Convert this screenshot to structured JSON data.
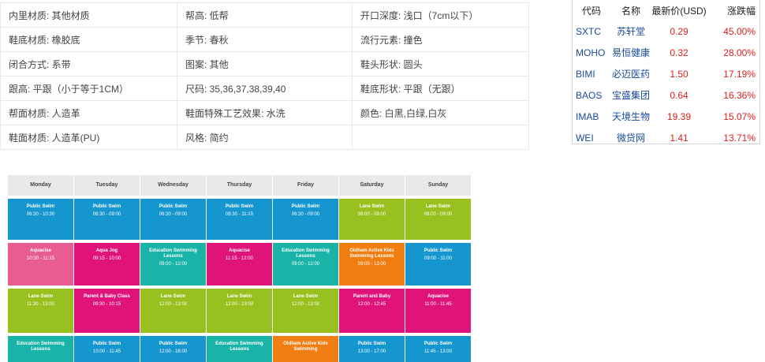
{
  "attributes": [
    [
      "内里材质: 其他材质",
      "帮高: 低帮",
      "开口深度: 浅口（7cm以下）"
    ],
    [
      "鞋底材质: 橡胶底",
      "季节: 春秋",
      "流行元素: 撞色"
    ],
    [
      "闭合方式: 系带",
      "图案: 其他",
      "鞋头形状: 圆头"
    ],
    [
      "跟高: 平跟（小于等于1CM）",
      "尺码: 35,36,37,38,39,40",
      "鞋底形状: 平跟（无跟）"
    ],
    [
      "帮面材质: 人造革",
      "鞋面特殊工艺效果: 水洗",
      "颜色: 白黑,白绿,白灰"
    ],
    [
      "鞋面材质: 人造革(PU)",
      "风格: 简约",
      ""
    ]
  ],
  "stocks": {
    "headers": {
      "code": "代码",
      "name": "名称",
      "price": "最新价(USD)",
      "change": "涨跌幅"
    },
    "rows": [
      {
        "code": "SXTC",
        "name": "苏轩堂",
        "price": "0.29",
        "change": "45.00%"
      },
      {
        "code": "MOHO",
        "name": "易恒健康",
        "price": "0.32",
        "change": "28.00%"
      },
      {
        "code": "BIMI",
        "name": "必迈医药",
        "price": "1.50",
        "change": "17.19%"
      },
      {
        "code": "BAOS",
        "name": "宝盛集团",
        "price": "0.64",
        "change": "16.36%"
      },
      {
        "code": "IMAB",
        "name": "天境生物",
        "price": "19.39",
        "change": "15.07%"
      },
      {
        "code": "WEI",
        "name": "微贷网",
        "price": "1.41",
        "change": "13.71%"
      }
    ]
  },
  "timetable": {
    "days": [
      "Monday",
      "Tuesday",
      "Wednesday",
      "Thursday",
      "Friday",
      "Saturday",
      "Sunday"
    ],
    "rows": [
      [
        {
          "title": "Public Swim",
          "time": "06:30 - 10:30",
          "color": "blue"
        },
        {
          "title": "Public Swim",
          "time": "06:30 - 09:00",
          "color": "blue"
        },
        {
          "title": "Public Swim",
          "time": "06:30 - 09:00",
          "color": "blue"
        },
        {
          "title": "Public Swim",
          "time": "06:30 - 11:15",
          "color": "blue"
        },
        {
          "title": "Public Swim",
          "time": "06:30 - 09:00",
          "color": "blue"
        },
        {
          "title": "Lane Swim",
          "time": "08:00 - 09:00",
          "color": "green"
        },
        {
          "title": "Lane Swim",
          "time": "08:00 - 09:00",
          "color": "green"
        }
      ],
      [
        {
          "title": "Aquacise",
          "time": "10:30 - 11:15",
          "color": "rose"
        },
        {
          "title": "Aqua Jog",
          "time": "09:15 - 10:00",
          "color": "pink"
        },
        {
          "title": "Education Swimming Lessons",
          "time": "09:00 - 12:00",
          "color": "teal"
        },
        {
          "title": "Aquacise",
          "time": "11:15 - 12:00",
          "color": "pink"
        },
        {
          "title": "Education Swimming Lessons",
          "time": "09:00 - 12:00",
          "color": "teal"
        },
        {
          "title": "Oldham Active Kids Swimming Lessons",
          "time": "09:00 - 13:00",
          "color": "orange"
        },
        {
          "title": "Public Swim",
          "time": "09:00 - 11:00",
          "color": "blue"
        }
      ],
      [
        {
          "title": "Lane Swim",
          "time": "11:30 - 13:00",
          "color": "green"
        },
        {
          "title": "Parent & Baby Class",
          "time": "09:30 - 10:15",
          "color": "pink"
        },
        {
          "title": "Lane Swim",
          "time": "12:00 - 13:00",
          "color": "green"
        },
        {
          "title": "Lane Swim",
          "time": "12:00 - 13:00",
          "color": "green"
        },
        {
          "title": "Lane Swim",
          "time": "12:00 - 13:00",
          "color": "green"
        },
        {
          "title": "Parent and Baby",
          "time": "12:00 - 12:45",
          "color": "pink"
        },
        {
          "title": "Aquacise",
          "time": "11:00 - 11:45",
          "color": "pink"
        }
      ],
      [
        {
          "title": "Education Swimming Lessons",
          "time": "",
          "color": "teal"
        },
        {
          "title": "Public Swim",
          "time": "10:00 - 11:45",
          "color": "blue"
        },
        {
          "title": "Public Swim",
          "time": "12:00 - 16:00",
          "color": "blue"
        },
        {
          "title": "Education Swimming Lessons",
          "time": "",
          "color": "teal"
        },
        {
          "title": "Oldham Active Kids Swimming",
          "time": "",
          "color": "orange"
        },
        {
          "title": "Public Swim",
          "time": "13:00 - 17:00",
          "color": "blue"
        },
        {
          "title": "Public Swim",
          "time": "11:45 - 13:00",
          "color": "blue"
        }
      ]
    ]
  }
}
